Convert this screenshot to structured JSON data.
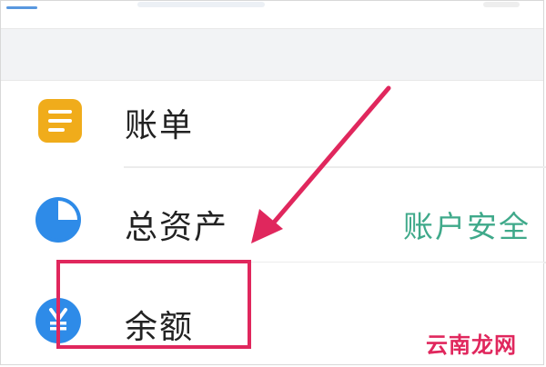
{
  "menu": {
    "items": [
      {
        "label": "账单",
        "icon": "bill-icon",
        "color": "#f0ac1b"
      },
      {
        "label": "总资产",
        "icon": "pie-chart-icon",
        "color": "#2e8be8"
      },
      {
        "label": "余额",
        "icon": "yuan-icon",
        "color": "#2e8be8"
      }
    ],
    "side_text": "账户安全"
  },
  "annotation": {
    "arrow_color": "#e0275d",
    "box_color": "#e0275d"
  },
  "watermark": "云南龙网"
}
